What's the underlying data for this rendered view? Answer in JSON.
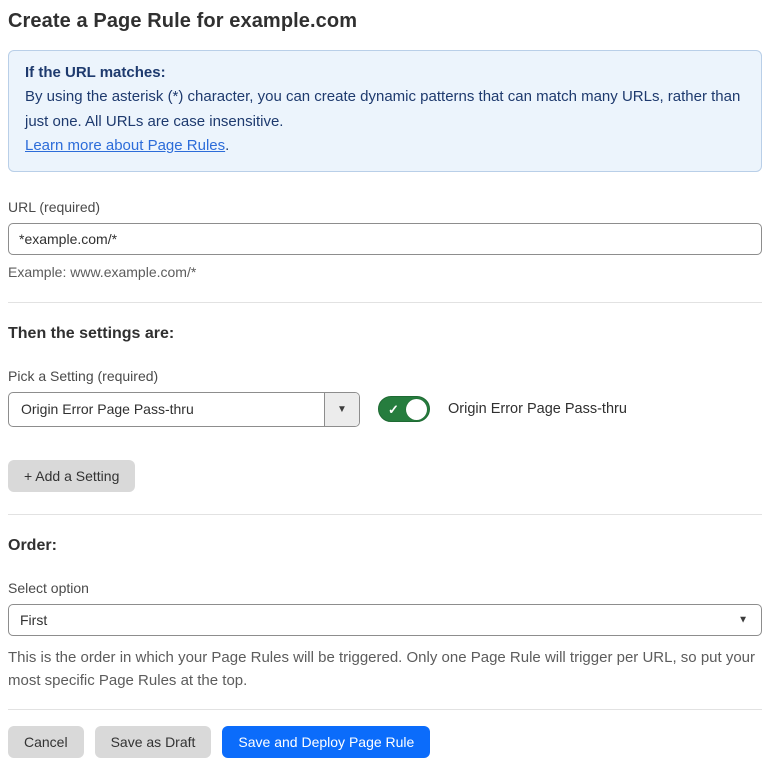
{
  "page": {
    "title": "Create a Page Rule for example.com"
  },
  "info_box": {
    "heading": "If the URL matches:",
    "body": "By using the asterisk (*) character, you can create dynamic patterns that can match many URLs, rather than just one. All URLs are case insensitive.",
    "link_label": "Learn more about Page Rules",
    "link_suffix": "."
  },
  "url_field": {
    "label": "URL (required)",
    "value": "*example.com/*",
    "helper": "Example: www.example.com/*"
  },
  "settings_section": {
    "heading": "Then the settings are:",
    "picker_label": "Pick a Setting (required)",
    "picker_value": "Origin Error Page Pass-thru",
    "toggle_state": "on",
    "toggle_label": "Origin Error Page Pass-thru",
    "add_setting_label": "+ Add a Setting"
  },
  "order_section": {
    "heading": "Order:",
    "select_label": "Select option",
    "select_value": "First",
    "helper": "This is the order in which your Page Rules will be triggered. Only one Page Rule will trigger per URL, so put your most specific Page Rules at the top."
  },
  "footer": {
    "cancel_label": "Cancel",
    "save_draft_label": "Save as Draft",
    "save_deploy_label": "Save and Deploy Page Rule"
  },
  "icons": {
    "dropdown_arrow": "▼",
    "toggle_check": "✓"
  },
  "colors": {
    "accent_blue": "#0b6cfb",
    "info_bg": "#ecf4fc",
    "info_border": "#b9cfe8",
    "info_text": "#1e3a6e",
    "link_blue": "#2c6cd9",
    "toggle_green": "#267d3e",
    "secondary_button_gray": "#d9d9d9"
  }
}
